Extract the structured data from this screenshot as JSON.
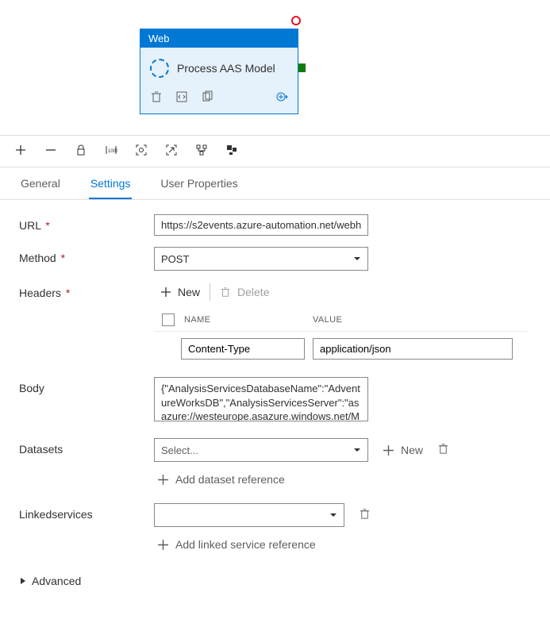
{
  "activity": {
    "type_label": "Web",
    "title": "Process AAS Model"
  },
  "tabs": {
    "general": "General",
    "settings": "Settings",
    "user_properties": "User Properties"
  },
  "form": {
    "url": {
      "label": "URL",
      "value": "https://s2events.azure-automation.net/webh"
    },
    "method": {
      "label": "Method",
      "value": "POST"
    },
    "headers": {
      "label": "Headers",
      "new_btn": "New",
      "delete_btn": "Delete",
      "col_name": "NAME",
      "col_value": "VALUE",
      "rows": [
        {
          "name": "Content-Type",
          "value": "application/json"
        }
      ]
    },
    "body": {
      "label": "Body",
      "value": "{\"AnalysisServicesDatabaseName\":\"AdventureWorksDB\",\"AnalysisServicesServer\":\"asazure://westeurope.asazure.windows.net/MyAn"
    },
    "datasets": {
      "label": "Datasets",
      "placeholder": "Select...",
      "new_btn": "New",
      "add_reference": "Add dataset reference"
    },
    "linkedservices": {
      "label": "Linkedservices",
      "value": "",
      "add_reference": "Add linked service reference"
    },
    "advanced": "Advanced"
  }
}
